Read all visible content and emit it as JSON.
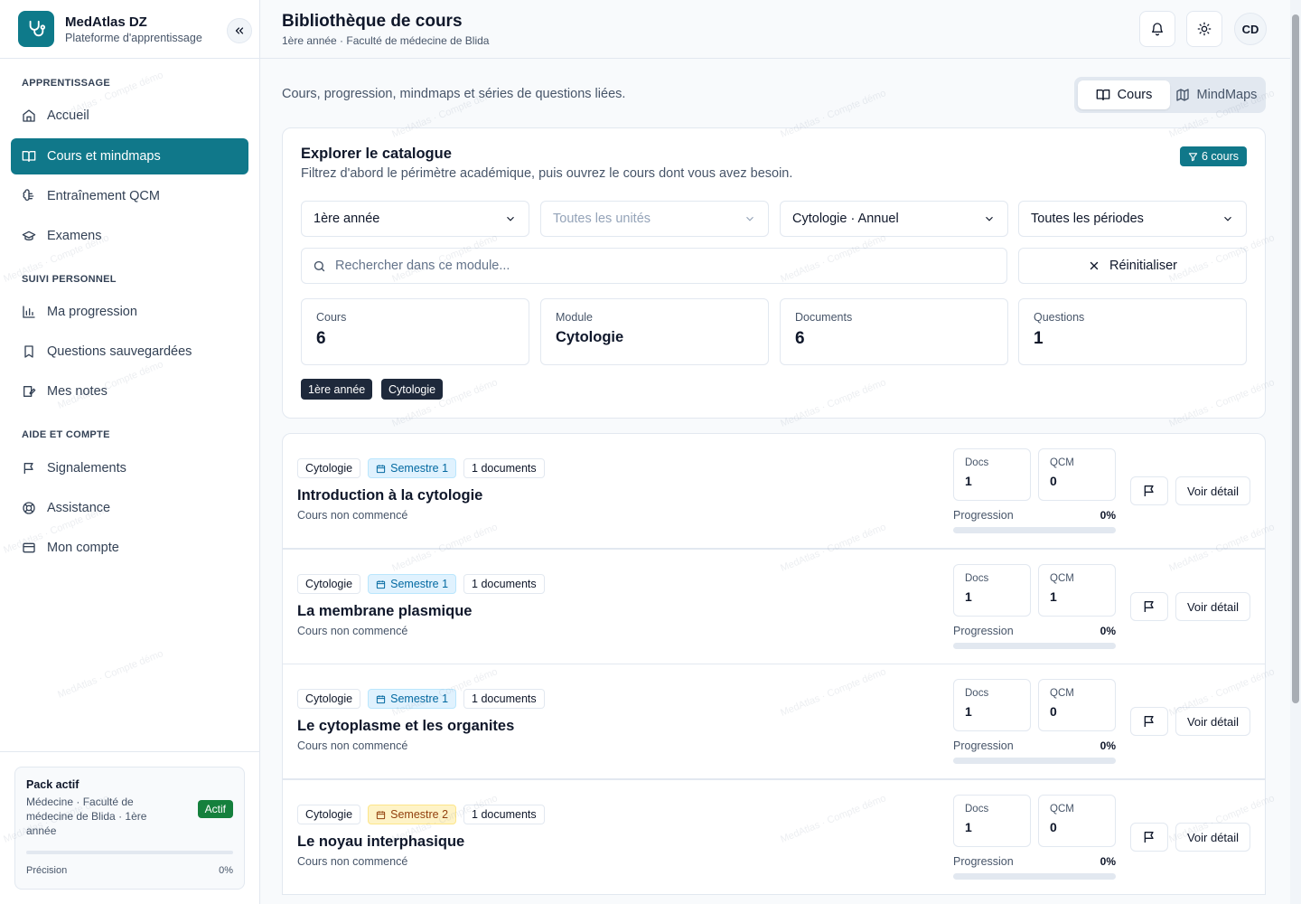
{
  "brand": {
    "title": "MedAtlas DZ",
    "subtitle": "Plateforme d'apprentissage",
    "logo_icon": "stethoscope-icon"
  },
  "sidebar": {
    "sections": [
      {
        "title": "APPRENTISSAGE"
      },
      {
        "title": "SUIVI PERSONNEL"
      },
      {
        "title": "AIDE ET COMPTE"
      }
    ],
    "items": [
      {
        "label": "Accueil",
        "icon": "home-icon"
      },
      {
        "label": "Cours et mindmaps",
        "icon": "book-open-icon",
        "active": true
      },
      {
        "label": "Entraînement QCM",
        "icon": "brain-icon"
      },
      {
        "label": "Examens",
        "icon": "graduation-cap-icon"
      },
      {
        "label": "Ma progression",
        "icon": "bar-chart-icon"
      },
      {
        "label": "Questions sauvegardées",
        "icon": "bookmark-icon"
      },
      {
        "label": "Mes notes",
        "icon": "notes-icon"
      },
      {
        "label": "Signalements",
        "icon": "flag-icon"
      },
      {
        "label": "Assistance",
        "icon": "life-buoy-icon"
      },
      {
        "label": "Mon compte",
        "icon": "card-icon"
      }
    ],
    "pack": {
      "title": "Pack actif",
      "description": "Médecine · Faculté de médecine de Blida · 1ère année",
      "badge": "Actif",
      "footer_label": "Précision",
      "footer_value": "0%",
      "fraction": 0
    }
  },
  "header": {
    "title": "Bibliothèque de cours",
    "subtitle": "1ère année · Faculté de médecine de Blida",
    "avatar": "CD"
  },
  "main": {
    "intro": "Cours, progression, mindmaps et séries de questions liées.",
    "view_toggle": {
      "cours": "Cours",
      "mindmaps": "MindMaps",
      "active": "cours"
    },
    "catalog": {
      "title": "Explorer le catalogue",
      "subtitle": "Filtrez d'abord le périmètre académique, puis ouvrez le cours dont vous avez besoin.",
      "count_badge": "6 cours",
      "filters": {
        "year": "1ère année",
        "units_placeholder": "Toutes les unités",
        "module": "Cytologie · Annuel",
        "period": "Toutes les périodes"
      },
      "search_placeholder": "Rechercher dans ce module...",
      "reset_label": "Réinitialiser",
      "stats": [
        {
          "label": "Cours",
          "value": "6"
        },
        {
          "label": "Module",
          "value": "Cytologie"
        },
        {
          "label": "Documents",
          "value": "6"
        },
        {
          "label": "Questions",
          "value": "1"
        }
      ],
      "active_chips": [
        "1ère année",
        "Cytologie"
      ]
    },
    "common": {
      "docs_label": "Docs",
      "qcm_label": "QCM",
      "progress_label": "Progression",
      "detail_label": "Voir détail"
    },
    "courses": [
      {
        "module": "Cytologie",
        "semester": "Semestre 1",
        "documents": "1 documents",
        "title": "Introduction à la cytologie",
        "status": "Cours non commencé",
        "docs": "1",
        "qcm": "0",
        "progress": "0%"
      },
      {
        "module": "Cytologie",
        "semester": "Semestre 1",
        "documents": "1 documents",
        "title": "La membrane plasmique",
        "status": "Cours non commencé",
        "docs": "1",
        "qcm": "1",
        "progress": "0%"
      },
      {
        "module": "Cytologie",
        "semester": "Semestre 1",
        "documents": "1 documents",
        "title": "Le cytoplasme et les organites",
        "status": "Cours non commencé",
        "docs": "1",
        "qcm": "0",
        "progress": "0%"
      },
      {
        "module": "Cytologie",
        "semester": "Semestre 2",
        "documents": "1 documents",
        "title": "Le noyau interphasique",
        "status": "Cours non commencé",
        "docs": "1",
        "qcm": "0",
        "progress": "0%"
      }
    ],
    "watermark": "MedAtlas · Compte démo"
  },
  "colors": {
    "accent": "#10788a",
    "semester1": "#0369a1",
    "semester2": "#92400e",
    "active_badge": "#15803d"
  }
}
